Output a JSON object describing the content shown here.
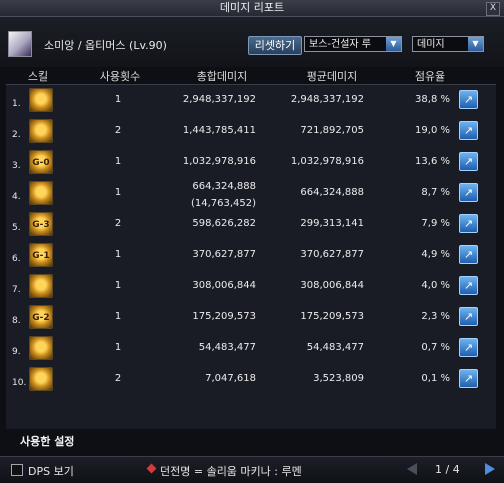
{
  "window": {
    "title": "데미지 리포트",
    "close_label": "X"
  },
  "header": {
    "character": "소미앙 / 옵티머스 (Lv.90)",
    "reset_button": "리셋하기",
    "target_select": "보스-건설자 루",
    "mode_select": "데미지"
  },
  "columns": {
    "skill": "스킬",
    "count": "사용횟수",
    "total": "총합데미지",
    "average": "평균데미지",
    "share": "점유율"
  },
  "rows": [
    {
      "rank": "1.",
      "icon": "skill-icon-1",
      "count": "1",
      "total": "2,948,337,192",
      "total_extra": "",
      "average": "2,948,337,192",
      "share": "38,8 %"
    },
    {
      "rank": "2.",
      "icon": "skill-icon-2",
      "count": "2",
      "total": "1,443,785,411",
      "total_extra": "",
      "average": "721,892,705",
      "share": "19,0 %"
    },
    {
      "rank": "3.",
      "icon": "skill-icon-3",
      "count": "1",
      "total": "1,032,978,916",
      "total_extra": "",
      "average": "1,032,978,916",
      "share": "13,6 %"
    },
    {
      "rank": "4.",
      "icon": "skill-icon-4",
      "count": "1",
      "total": "664,324,888",
      "total_extra": "(14,763,452)",
      "average": "664,324,888",
      "share": "8,7 %"
    },
    {
      "rank": "5.",
      "icon": "skill-icon-5",
      "count": "2",
      "total": "598,626,282",
      "total_extra": "",
      "average": "299,313,141",
      "share": "7,9 %"
    },
    {
      "rank": "6.",
      "icon": "skill-icon-6",
      "count": "1",
      "total": "370,627,877",
      "total_extra": "",
      "average": "370,627,877",
      "share": "4,9 %"
    },
    {
      "rank": "7.",
      "icon": "skill-icon-7",
      "count": "1",
      "total": "308,006,844",
      "total_extra": "",
      "average": "308,006,844",
      "share": "4,0 %"
    },
    {
      "rank": "8.",
      "icon": "skill-icon-8",
      "count": "1",
      "total": "175,209,573",
      "total_extra": "",
      "average": "175,209,573",
      "share": "2,3 %"
    },
    {
      "rank": "9.",
      "icon": "skill-icon-9",
      "count": "1",
      "total": "54,483,477",
      "total_extra": "",
      "average": "54,483,477",
      "share": "0,7 %"
    },
    {
      "rank": "10.",
      "icon": "skill-icon-10",
      "count": "2",
      "total": "7,047,618",
      "total_extra": "",
      "average": "3,523,809",
      "share": "0,1 %"
    }
  ],
  "settings_label": "사용한 설정",
  "footer": {
    "dps_label": "DPS 보기",
    "dungeon": "던전명 = 솔리움 마키나 : 루멘",
    "page": "1 / 4"
  },
  "icon_glyphs": [
    "",
    "",
    "G-0",
    "",
    "G-3",
    "G-1",
    "",
    "G-2",
    "",
    ""
  ],
  "colors": {
    "accent": "#4f8de0",
    "share_button": "#2f7fd8"
  }
}
